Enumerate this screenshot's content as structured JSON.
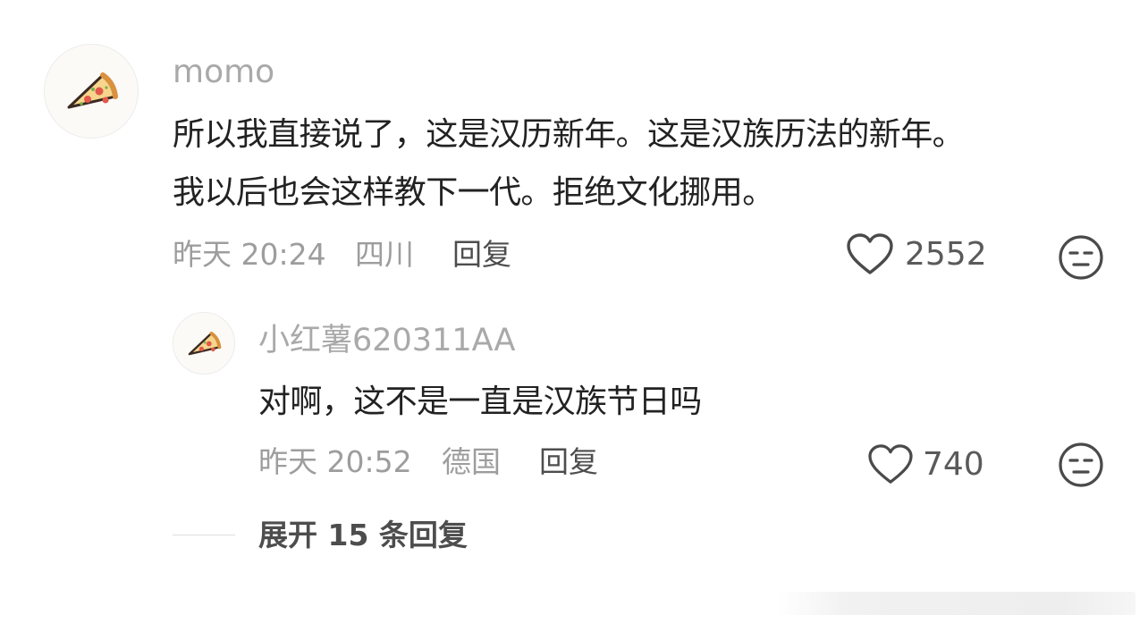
{
  "colors": {
    "username": "#a9a9a9",
    "content": "#222222",
    "meta": "#9d9d9d",
    "action": "#4d4d4d"
  },
  "comment": {
    "avatar_icon": "pizza-slice-icon",
    "username": "momo",
    "line1": "所以我直接说了，这是汉历新年。这是汉族历法的新年。",
    "line2": "我以后也会这样教下一代。拒绝文化挪用。",
    "time": "昨天 20:24",
    "location": "四川",
    "reply_label": "回复",
    "likes": "2552",
    "like_icon": "heart-outline-icon",
    "dislike_icon": "meh-face-icon"
  },
  "reply": {
    "avatar_icon": "pizza-slice-icon",
    "username": "小红薯620311AA",
    "text": "对啊，这不是一直是汉族节日吗",
    "time": "昨天 20:52",
    "location": "德国",
    "reply_label": "回复",
    "likes": "740",
    "like_icon": "heart-outline-icon",
    "dislike_icon": "meh-face-icon"
  },
  "expand": {
    "label": "展开 15 条回复"
  }
}
